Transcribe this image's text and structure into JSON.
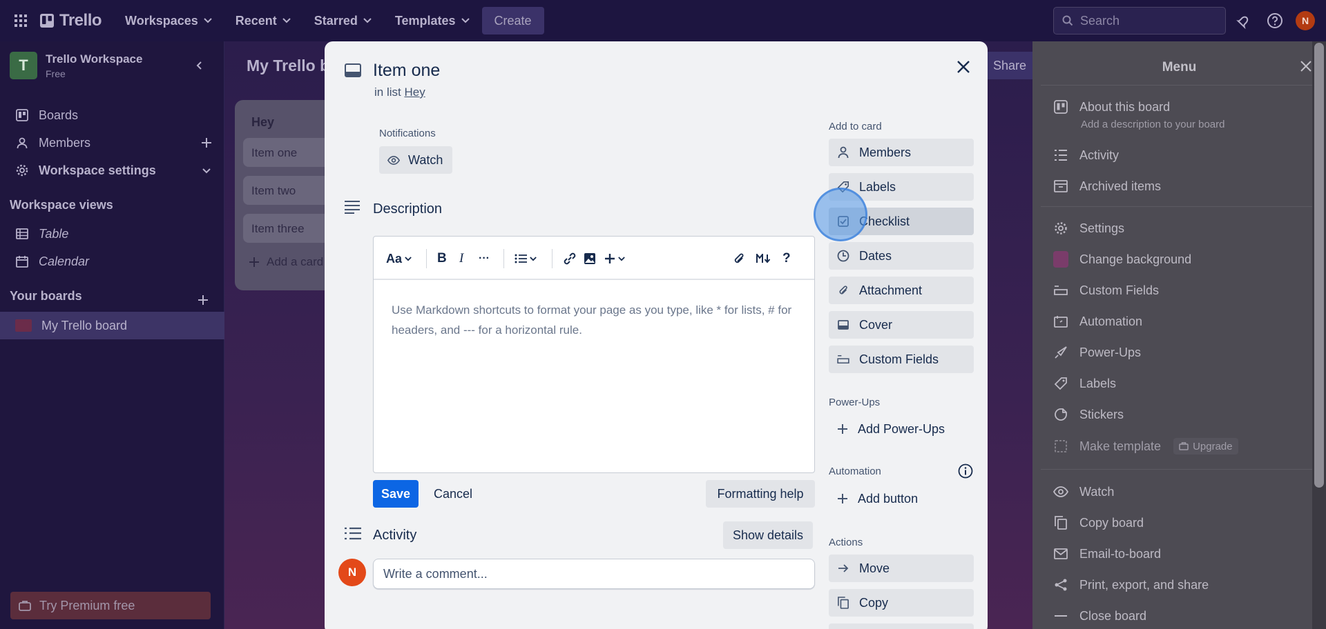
{
  "topbar": {
    "brand": "Trello",
    "nav": [
      "Workspaces",
      "Recent",
      "Starred",
      "Templates"
    ],
    "create_label": "Create",
    "search_placeholder": "Search",
    "avatar_initial": "N"
  },
  "sidebar": {
    "workspace_logo": "T",
    "workspace_name": "Trello Workspace",
    "workspace_plan": "Free",
    "items": [
      {
        "label": "Boards",
        "icon": "trello-icon"
      },
      {
        "label": "Members",
        "icon": "person-icon"
      },
      {
        "label": "Workspace settings",
        "icon": "gear-icon"
      }
    ],
    "views_heading": "Workspace views",
    "views": [
      {
        "label": "Table",
        "icon": "table-icon"
      },
      {
        "label": "Calendar",
        "icon": "calendar-icon"
      }
    ],
    "your_boards_heading": "Your boards",
    "boards": [
      "My Trello board"
    ],
    "premium_label": "Try Premium free"
  },
  "board": {
    "title": "My Trello board",
    "share_label": "Share",
    "list": {
      "title": "Hey",
      "cards": [
        "Item one",
        "Item two",
        "Item three"
      ],
      "add_card": "Add a card"
    }
  },
  "menu": {
    "title": "Menu",
    "about_title": "About this board",
    "about_sub": "Add a description to your board",
    "items_a": [
      "Activity",
      "Archived items"
    ],
    "items_b": [
      "Settings",
      "Change background",
      "Custom Fields",
      "Automation",
      "Power-Ups",
      "Labels",
      "Stickers",
      "Make template"
    ],
    "upgrade_label": "Upgrade",
    "items_c": [
      "Watch",
      "Copy board",
      "Email-to-board",
      "Print, export, and share",
      "Close board"
    ]
  },
  "card": {
    "title": "Item one",
    "in_list_prefix": "in list",
    "list_name": "Hey",
    "notifications_label": "Notifications",
    "watch_label": "Watch",
    "description_title": "Description",
    "editor_toolbar": {
      "text_style": "Aa",
      "bold": "B",
      "italic": "I",
      "more": "···",
      "help": "?"
    },
    "editor_placeholder": "Use Markdown shortcuts to format your page as you type, like * for lists, # for headers, and --- for a horizontal rule.",
    "save_label": "Save",
    "cancel_label": "Cancel",
    "formatting_help_label": "Formatting help",
    "activity_title": "Activity",
    "show_details_label": "Show details",
    "comment_avatar": "N",
    "comment_placeholder": "Write a comment...",
    "add_to_card_label": "Add to card",
    "add_to_card": [
      "Members",
      "Labels",
      "Checklist",
      "Dates",
      "Attachment",
      "Cover",
      "Custom Fields"
    ],
    "powerups_label": "Power-Ups",
    "add_powerups_label": "Add Power-Ups",
    "automation_label": "Automation",
    "add_button_label": "Add button",
    "actions_label": "Actions",
    "actions": [
      "Move",
      "Copy"
    ]
  },
  "colors": {
    "primary": "#0c66e4",
    "topbar_bg": "#1d1540",
    "modal_bg": "#f1f2f4",
    "avatar": "#e34919"
  }
}
